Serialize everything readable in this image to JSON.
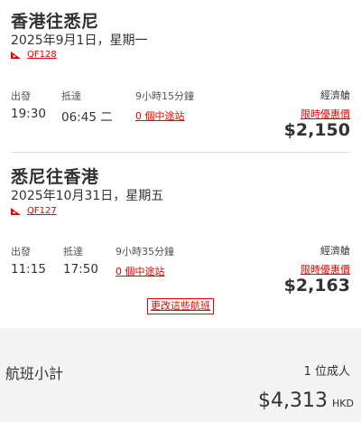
{
  "flights": [
    {
      "route": "香港往悉尼",
      "date": "2025年9月1日，星期一",
      "flight_number": "QF128",
      "depart_label": "出發",
      "arrive_label": "抵達",
      "depart_time": "19:30",
      "arrive_time": "06:45 二",
      "duration": "9小時15分鐘",
      "stops": "0 個中途站",
      "cabin": "經濟艙",
      "offer": "限時優惠價",
      "price": "$2,150"
    },
    {
      "route": "悉尼往香港",
      "date": "2025年10月31日，星期五",
      "flight_number": "QF127",
      "depart_label": "出發",
      "arrive_label": "抵達",
      "depart_time": "11:15",
      "arrive_time": "17:50",
      "duration": "9小時35分鐘",
      "stops": "0 個中途站",
      "cabin": "經濟艙",
      "offer": "限時優惠價",
      "price": "$2,163"
    }
  ],
  "change_flights_label": "更改這些航班",
  "summary": {
    "title": "航班小計",
    "passengers": "1 位成人",
    "total": "$4,313",
    "currency": "HKD"
  },
  "colors": {
    "accent_red": "#e40000",
    "text": "#323232",
    "summary_bg": "#f4f4f4"
  },
  "icons": {
    "airline_logo": "qantas-kangaroo-logo"
  }
}
